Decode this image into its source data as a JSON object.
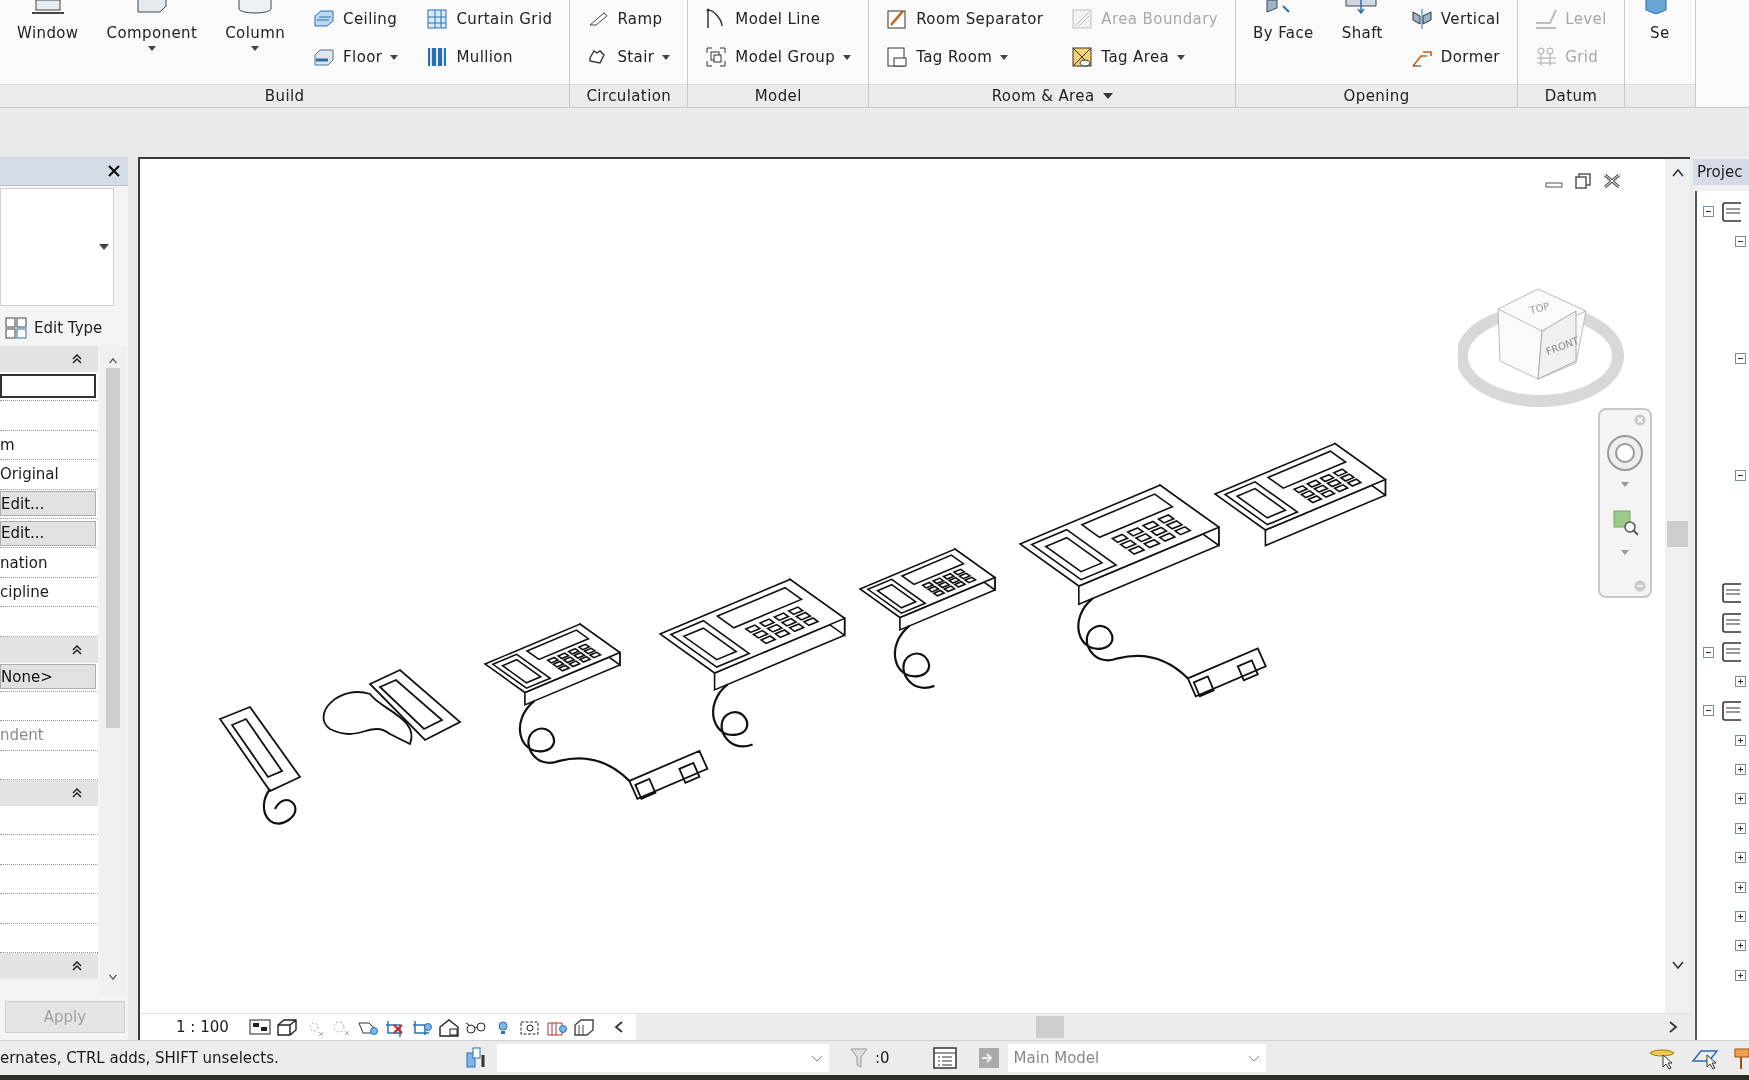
{
  "ribbon": {
    "panels": [
      {
        "label": "Build",
        "menu": false,
        "items": [
          {
            "kind": "large",
            "label": "Window",
            "dropdown": false,
            "disabled": false
          },
          {
            "kind": "large",
            "label": "Component",
            "dropdown": true,
            "disabled": false
          },
          {
            "kind": "large",
            "label": "Column",
            "dropdown": true,
            "disabled": false
          },
          {
            "kind": "small",
            "label": "Ceiling",
            "dropdown": false,
            "disabled": false
          },
          {
            "kind": "small",
            "label": "Floor",
            "dropdown": true,
            "disabled": false
          },
          {
            "kind": "small",
            "label": "Curtain Grid",
            "dropdown": false,
            "disabled": false
          },
          {
            "kind": "small",
            "label": "Mullion",
            "dropdown": false,
            "disabled": false
          }
        ]
      },
      {
        "label": "Circulation",
        "menu": false,
        "items": [
          {
            "kind": "small",
            "label": "Ramp",
            "dropdown": false,
            "disabled": false
          },
          {
            "kind": "small",
            "label": "Stair",
            "dropdown": true,
            "disabled": false
          }
        ]
      },
      {
        "label": "Model",
        "menu": false,
        "items": [
          {
            "kind": "small",
            "label": "Model Line",
            "dropdown": false,
            "disabled": false
          },
          {
            "kind": "small",
            "label": "Model Group",
            "dropdown": true,
            "disabled": false
          }
        ]
      },
      {
        "label": "Room & Area",
        "menu": true,
        "items": [
          {
            "kind": "small",
            "label": "Room Separator",
            "dropdown": false,
            "disabled": false
          },
          {
            "kind": "small",
            "label": "Tag Room",
            "dropdown": true,
            "disabled": false
          },
          {
            "kind": "small",
            "label": "Area Boundary",
            "dropdown": false,
            "disabled": true
          },
          {
            "kind": "small",
            "label": "Tag Area",
            "dropdown": true,
            "disabled": false
          }
        ]
      },
      {
        "label": "Opening",
        "menu": false,
        "items": [
          {
            "kind": "large",
            "label": "By Face",
            "dropdown": false,
            "disabled": false
          },
          {
            "kind": "large",
            "label": "Shaft",
            "dropdown": false,
            "disabled": false
          },
          {
            "kind": "small",
            "label": "Vertical",
            "dropdown": false,
            "disabled": false
          },
          {
            "kind": "small",
            "label": "Dormer",
            "dropdown": false,
            "disabled": false
          }
        ]
      },
      {
        "label": "Datum",
        "menu": false,
        "items": [
          {
            "kind": "small",
            "label": "Level",
            "dropdown": false,
            "disabled": true
          },
          {
            "kind": "small",
            "label": "Grid",
            "dropdown": false,
            "disabled": true
          }
        ]
      },
      {
        "menu": false,
        "items": [
          {
            "kind": "large",
            "label": "Se",
            "dropdown": false,
            "disabled": false
          }
        ]
      }
    ]
  },
  "properties": {
    "edit_type": "Edit Type",
    "groups": [
      {
        "expanded": true,
        "rows": [
          {
            "kind": "field"
          },
          {
            "kind": "blank"
          },
          {
            "kind": "text",
            "value": "m",
            "disabled": false
          },
          {
            "kind": "text",
            "value": "Original",
            "disabled": false
          },
          {
            "kind": "button",
            "value": "Edit..."
          },
          {
            "kind": "button",
            "value": "Edit..."
          },
          {
            "kind": "text",
            "value": "nation",
            "disabled": false
          },
          {
            "kind": "text",
            "value": "cipline",
            "disabled": false
          },
          {
            "kind": "blank"
          }
        ]
      },
      {
        "expanded": true,
        "rows": [
          {
            "kind": "button",
            "value": "None>"
          },
          {
            "kind": "blank"
          },
          {
            "kind": "text",
            "value": "ndent",
            "disabled": true
          },
          {
            "kind": "blank"
          }
        ]
      },
      {
        "expanded": true,
        "rows": [
          {
            "kind": "blank"
          },
          {
            "kind": "blank"
          },
          {
            "kind": "blank"
          },
          {
            "kind": "blank"
          },
          {
            "kind": "blank"
          }
        ]
      },
      {
        "expanded": true
      }
    ],
    "apply": {
      "label": "Apply",
      "disabled": true
    }
  },
  "view": {
    "viewcube": {
      "top": "TOP",
      "front": "FRONT"
    },
    "scale": "1 : 100"
  },
  "project_browser": {
    "title": "Projec",
    "tree": [
      {
        "kind": "folder",
        "expanded": true,
        "children": [
          {
            "kind": "folder",
            "expanded": true
          },
          {
            "kind": "folder",
            "expanded": true
          },
          {
            "kind": "folder",
            "expanded": true
          }
        ]
      },
      {
        "kind": "item"
      },
      {
        "kind": "item"
      },
      {
        "kind": "folder",
        "expanded": true,
        "children": [
          {
            "kind": "folder",
            "expanded": false
          }
        ]
      },
      {
        "kind": "folder",
        "expanded": true,
        "children": [
          {
            "kind": "folder",
            "expanded": false
          },
          {
            "kind": "folder",
            "expanded": false
          },
          {
            "kind": "folder",
            "expanded": false
          },
          {
            "kind": "folder",
            "expanded": false
          },
          {
            "kind": "folder",
            "expanded": false
          },
          {
            "kind": "folder",
            "expanded": false
          },
          {
            "kind": "folder",
            "expanded": false
          },
          {
            "kind": "folder",
            "expanded": false
          },
          {
            "kind": "folder",
            "expanded": false
          }
        ]
      }
    ]
  },
  "status_bar": {
    "message": "ernates, CTRL adds, SHIFT unselects.",
    "selection_count": ":0",
    "model": "Main Model"
  }
}
